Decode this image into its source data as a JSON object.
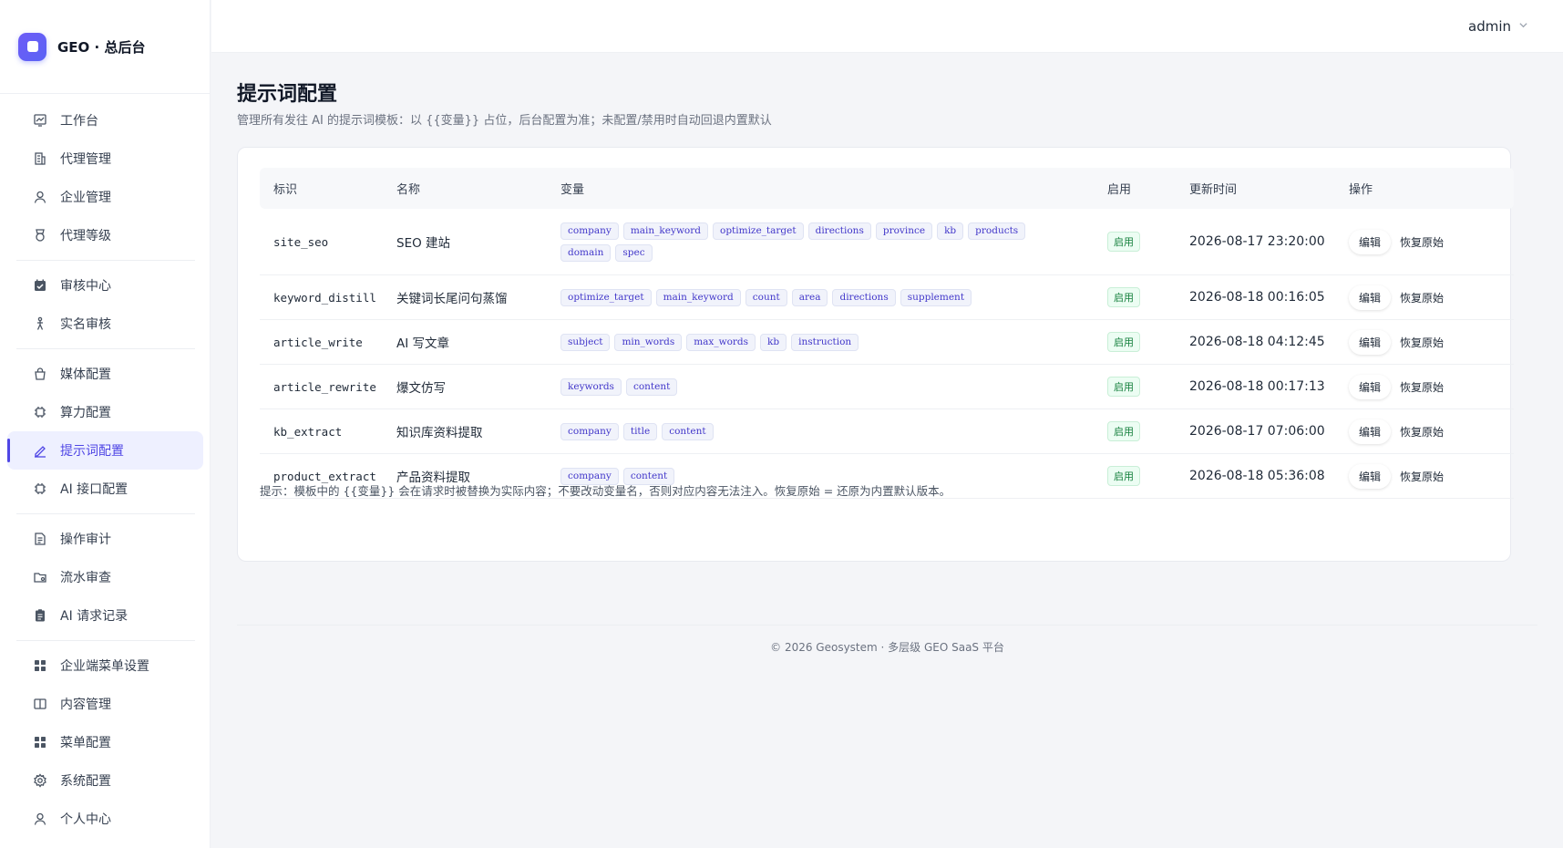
{
  "brand": {
    "name": "GEO · 总后台"
  },
  "user": {
    "name": "admin"
  },
  "sidebar": {
    "groups": [
      [
        {
          "label": "工作台",
          "icon": "chart-icon"
        },
        {
          "label": "代理管理",
          "icon": "building-icon"
        },
        {
          "label": "企业管理",
          "icon": "user-icon"
        },
        {
          "label": "代理等级",
          "icon": "medal-icon"
        }
      ],
      [
        {
          "label": "审核中心",
          "icon": "calendar-check-icon"
        },
        {
          "label": "实名审核",
          "icon": "person-icon"
        }
      ],
      [
        {
          "label": "媒体配置",
          "icon": "bag-icon"
        },
        {
          "label": "算力配置",
          "icon": "chip-icon"
        },
        {
          "label": "提示词配置",
          "icon": "pen-icon",
          "active": true
        },
        {
          "label": "AI 接口配置",
          "icon": "chip-icon"
        }
      ],
      [
        {
          "label": "操作审计",
          "icon": "document-icon"
        },
        {
          "label": "流水审查",
          "icon": "folder-icon"
        },
        {
          "label": "AI 请求记录",
          "icon": "clipboard-icon"
        }
      ],
      [
        {
          "label": "企业端菜单设置",
          "icon": "grid-icon"
        },
        {
          "label": "内容管理",
          "icon": "book-icon"
        },
        {
          "label": "菜单配置",
          "icon": "grid-icon"
        },
        {
          "label": "系统配置",
          "icon": "gear-icon"
        },
        {
          "label": "个人中心",
          "icon": "user-icon"
        }
      ]
    ]
  },
  "page": {
    "title": "提示词配置",
    "subtitle": "管理所有发往 AI 的提示词模板：以 {{变量}} 占位，后台配置为准；未配置/禁用时自动回退内置默认"
  },
  "table": {
    "headers": {
      "id": "标识",
      "name": "名称",
      "vars": "变量",
      "enabled": "启用",
      "updated": "更新时间",
      "ops": "操作"
    },
    "rows": [
      {
        "id": "site_seo",
        "name": "SEO 建站",
        "vars": [
          "company",
          "main_keyword",
          "optimize_target",
          "directions",
          "province",
          "kb",
          "products",
          "domain",
          "spec"
        ],
        "enabled": "启用",
        "updated": "2026-08-17 23:20:00",
        "edit": "编辑",
        "restore": "恢复原始"
      },
      {
        "id": "keyword_distill",
        "name": "关键词长尾问句蒸馏",
        "vars": [
          "optimize_target",
          "main_keyword",
          "count",
          "area",
          "directions",
          "supplement"
        ],
        "enabled": "启用",
        "updated": "2026-08-18 00:16:05",
        "edit": "编辑",
        "restore": "恢复原始"
      },
      {
        "id": "article_write",
        "name": "AI 写文章",
        "vars": [
          "subject",
          "min_words",
          "max_words",
          "kb",
          "instruction"
        ],
        "enabled": "启用",
        "updated": "2026-08-18 04:12:45",
        "edit": "编辑",
        "restore": "恢复原始"
      },
      {
        "id": "article_rewrite",
        "name": "爆文仿写",
        "vars": [
          "keywords",
          "content"
        ],
        "enabled": "启用",
        "updated": "2026-08-18 00:17:13",
        "edit": "编辑",
        "restore": "恢复原始"
      },
      {
        "id": "kb_extract",
        "name": "知识库资料提取",
        "vars": [
          "company",
          "title",
          "content"
        ],
        "enabled": "启用",
        "updated": "2026-08-17 07:06:00",
        "edit": "编辑",
        "restore": "恢复原始"
      },
      {
        "id": "product_extract",
        "name": "产品资料提取",
        "vars": [
          "company",
          "content"
        ],
        "enabled": "启用",
        "updated": "2026-08-18 05:36:08",
        "edit": "编辑",
        "restore": "恢复原始"
      }
    ]
  },
  "hint": "提示：模板中的 {{变量}} 会在请求时被替换为实际内容；不要改动变量名，否则对应内容无法注入。恢复原始 = 还原为内置默认版本。",
  "footer": "© 2026 Geosystem · 多层级 GEO SaaS 平台",
  "colors": {
    "accent": "#4f46e5",
    "success": "#15803d",
    "tag_text": "#4338ca"
  }
}
